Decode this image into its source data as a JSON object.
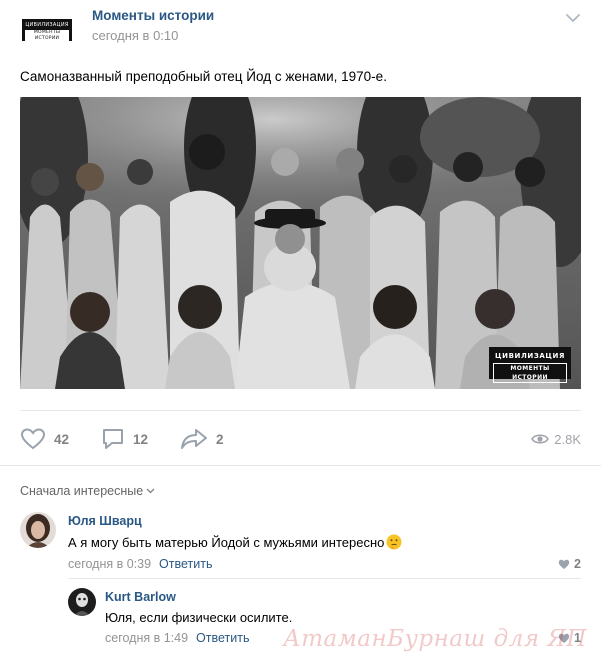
{
  "post": {
    "group_name": "Моменты истории",
    "time": "сегодня в 0:10",
    "text": "Самоназванный преподобный отец Йод с женами, 1970-е.",
    "avatar_logo": {
      "line1": "ЦИВИЛИЗАЦИЯ",
      "line2": "МОМЕНТЫ ИСТОРИИ"
    },
    "photo_watermark": {
      "line1": "ЦИВИЛИЗАЦИЯ",
      "line2": "МОМЕНТЫ ИСТОРИИ"
    }
  },
  "actions": {
    "likes": "42",
    "comments": "12",
    "shares": "2",
    "views": "2.8K"
  },
  "comments_sort": "Сначала интересные",
  "comments": [
    {
      "author": "Юля Шварц",
      "text": "А я могу быть матерью Йодой с мужьями интересно",
      "time": "сегодня в 0:39",
      "reply_label": "Ответить",
      "likes": "2",
      "emoji": "thinking-face"
    },
    {
      "author": "Kurt Barlow",
      "text": "Юля, если физически осилите.",
      "time": "сегодня в 1:49",
      "reply_label": "Ответить",
      "likes": "1"
    }
  ],
  "site_watermark": "АтаманБурнаш для ЯП",
  "colors": {
    "link": "#2a5885",
    "muted": "#939393",
    "icon": "#828282",
    "divider": "#e7e8ec"
  }
}
